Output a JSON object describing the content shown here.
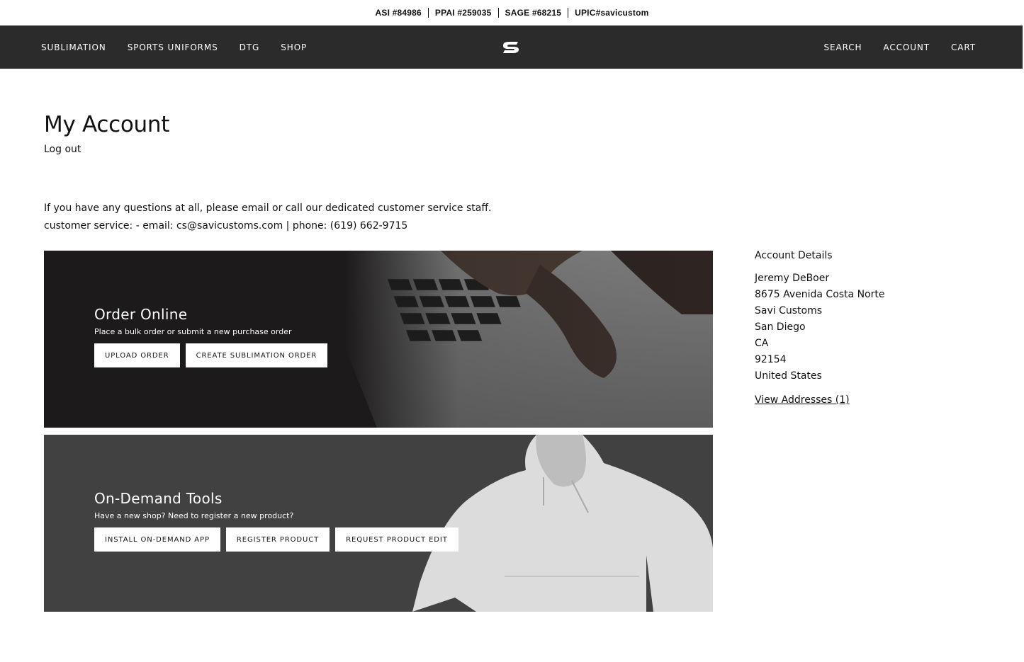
{
  "topbar": {
    "credentials": [
      "ASI #84986",
      "PPAI #259035",
      "SAGE #68215",
      "UPIC#savicustom"
    ]
  },
  "nav": {
    "left": [
      "SUBLIMATION",
      "SPORTS UNIFORMS",
      "DTG",
      "SHOP"
    ],
    "right": [
      "SEARCH",
      "ACCOUNT",
      "CART"
    ],
    "logo_icon": "savi-s-logo-icon"
  },
  "page": {
    "title": "My Account",
    "logout": "Log out",
    "intro_line1": "If you have any questions at all, please email or call our dedicated customer service staff.",
    "intro_line2": "customer service: - email: cs@savicustoms.com | phone: (619) 662-9715"
  },
  "panels": {
    "order": {
      "title": "Order Online",
      "subtitle": "Place a bulk order or submit a new purchase order",
      "buttons": [
        "UPLOAD ORDER",
        "CREATE SUBLIMATION ORDER"
      ],
      "image": "laptop-keyboard-photo"
    },
    "tools": {
      "title": "On-Demand Tools",
      "subtitle": "Have a new shop? Need to register a new product?",
      "buttons": [
        "INSTALL ON-DEMAND APP",
        "REGISTER PRODUCT",
        "REQUEST PRODUCT EDIT"
      ],
      "image": "white-hoodie-photo"
    }
  },
  "account": {
    "heading": "Account Details",
    "lines": [
      "Jeremy DeBoer",
      "8675 Avenida Costa Norte",
      "Savi Customs",
      "San Diego",
      "CA",
      "92154",
      "United States"
    ],
    "view_addresses": "View Addresses (1)"
  },
  "colors": {
    "nav_bg": "#2b2b2b",
    "order_panel_bg": "#1c1a1b",
    "tools_panel_bg": "#414141"
  }
}
